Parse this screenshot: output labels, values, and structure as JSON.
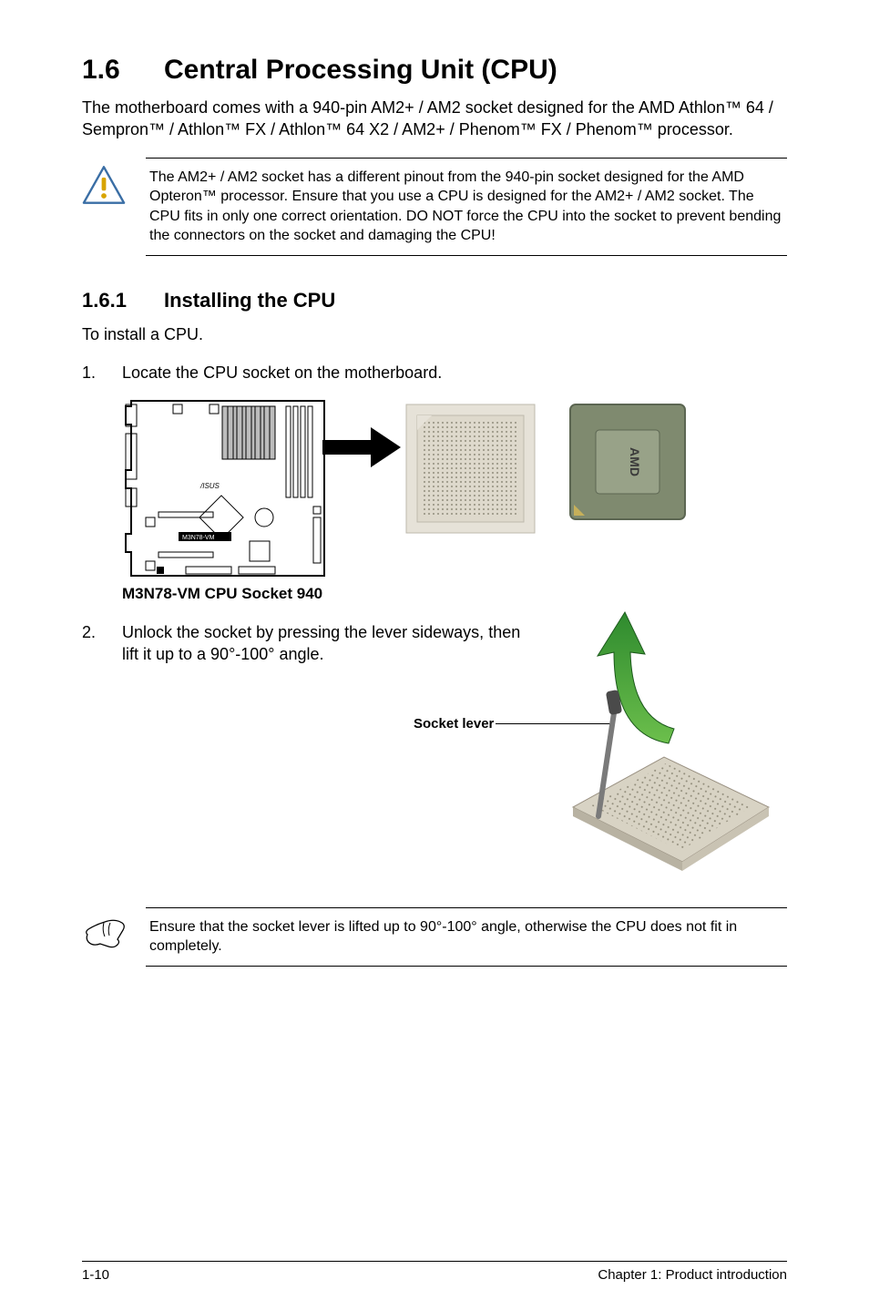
{
  "section": {
    "number": "1.6",
    "title": "Central Processing Unit (CPU)",
    "intro": "The motherboard comes with a 940-pin AM2+ / AM2 socket designed for the AMD Athlon™ 64 / Sempron™ / Athlon™ FX / Athlon™ 64 X2 / AM2+ / Phenom™ FX / Phenom™ processor."
  },
  "warning": {
    "text": "The AM2+ / AM2 socket has a different pinout from the 940-pin socket designed for the AMD Opteron™ processor. Ensure that you use a CPU is designed for the AM2+ / AM2 socket. The CPU fits in only one correct orientation. DO NOT force the CPU into the socket to prevent bending the connectors on the socket and damaging the CPU!"
  },
  "subsection": {
    "number": "1.6.1",
    "title": "Installing the CPU",
    "lead": "To install a CPU."
  },
  "steps": {
    "s1": {
      "num": "1.",
      "text": "Locate the CPU socket on the motherboard."
    },
    "s2": {
      "num": "2.",
      "text": "Unlock the socket by pressing the lever sideways, then lift it up to a 90°-100° angle."
    }
  },
  "figures": {
    "mb_caption": "M3N78-VM CPU Socket 940",
    "mb_board_label": "M3N78-VM",
    "socket_lever_label": "Socket lever",
    "cpu_brand": "AMD"
  },
  "note": {
    "text": "Ensure that the socket  lever is lifted up to 90°-100° angle, otherwise the CPU does not fit in completely."
  },
  "footer": {
    "left": "1-10",
    "right": "Chapter 1: Product introduction"
  }
}
